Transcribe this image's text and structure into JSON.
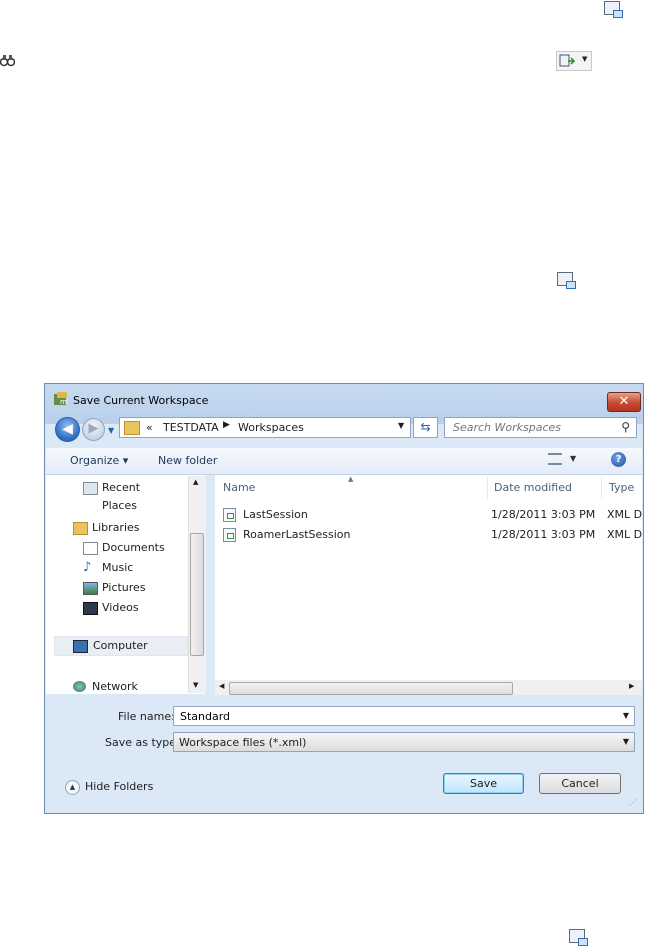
{
  "dialog": {
    "title": "Save Current Workspace",
    "close_label": "✕",
    "address": {
      "overflow": "«",
      "crumbs": [
        "TESTDATA",
        "Workspaces"
      ]
    },
    "search_placeholder": "Search Workspaces",
    "toolbar": {
      "organize": "Organize ▾",
      "new_folder": "New folder",
      "help": "?"
    },
    "nav": {
      "items": [
        {
          "label": "Recent Places",
          "icon": "recent-places-icon"
        },
        {
          "label": "Libraries",
          "icon": "libraries-icon"
        },
        {
          "label": "Documents",
          "icon": "documents-icon"
        },
        {
          "label": "Music",
          "icon": "music-icon"
        },
        {
          "label": "Pictures",
          "icon": "pictures-icon"
        },
        {
          "label": "Videos",
          "icon": "videos-icon"
        },
        {
          "label": "Computer",
          "icon": "computer-icon"
        },
        {
          "label": "Network",
          "icon": "network-icon"
        }
      ]
    },
    "columns": {
      "name": "Name",
      "date": "Date modified",
      "type": "Type"
    },
    "files": [
      {
        "name": "LastSession",
        "date": "1/28/2011 3:03 PM",
        "type": "XML D"
      },
      {
        "name": "RoamerLastSession",
        "date": "1/28/2011 3:03 PM",
        "type": "XML D"
      }
    ],
    "file_name_label": "File name:",
    "file_name_value": "Standard",
    "save_type_label": "Save as type:",
    "save_type_value": "Workspace files (*.xml)",
    "hide_folders": "Hide Folders",
    "save_button": "Save",
    "cancel_button": "Cancel"
  },
  "colors": {
    "title_bg": "#c7daf0",
    "close_red": "#c74a32",
    "accent_blue": "#2c6bc4",
    "default_button": "#bee6fd"
  }
}
